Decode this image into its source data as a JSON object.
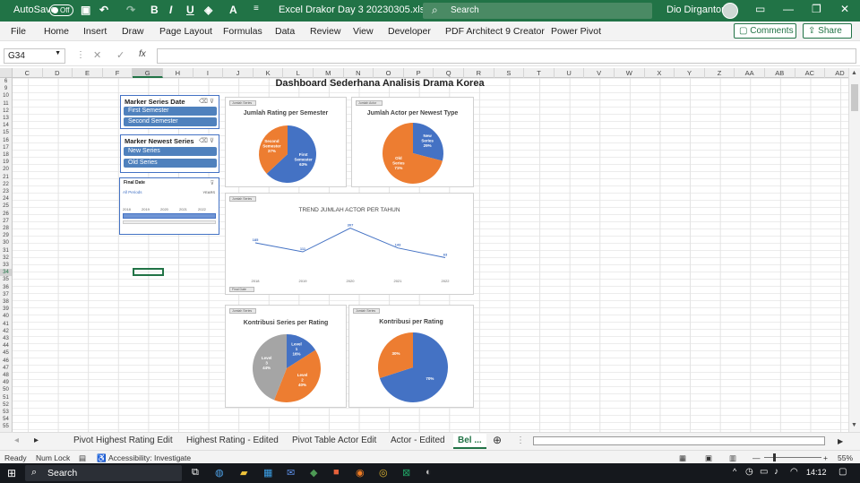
{
  "titlebar": {
    "autosave_label": "AutoSave",
    "autosave_state": "Off",
    "filename": "Excel Drakor Day 3 20230305.xlsx  -  E...",
    "search_placeholder": "Search",
    "user_name": "Dio Dirgantoro"
  },
  "menu": {
    "items": [
      "File",
      "Home",
      "Insert",
      "Draw",
      "Page Layout",
      "Formulas",
      "Data",
      "Review",
      "View",
      "Developer",
      "PDF Architect 9 Creator",
      "Power Pivot"
    ],
    "comments_label": "Comments",
    "share_label": "Share"
  },
  "formula_bar": {
    "name_box": "G34",
    "fx_label": "fx",
    "formula": ""
  },
  "grid": {
    "columns": [
      "C",
      "D",
      "E",
      "F",
      "G",
      "H",
      "I",
      "J",
      "K",
      "L",
      "M",
      "N",
      "O",
      "P",
      "Q",
      "R",
      "S",
      "T",
      "U",
      "V",
      "W",
      "X",
      "Y",
      "Z",
      "AA",
      "AB",
      "AC",
      "AD"
    ],
    "rows": [
      "6",
      "9",
      "10",
      "11",
      "12",
      "13",
      "14",
      "15",
      "16",
      "17",
      "18",
      "19",
      "20",
      "21",
      "22",
      "23",
      "24",
      "25",
      "26",
      "27",
      "28",
      "29",
      "30",
      "31",
      "32",
      "33",
      "34",
      "35",
      "36",
      "37",
      "38",
      "39",
      "40",
      "41",
      "42",
      "43",
      "44",
      "45",
      "46",
      "47",
      "48",
      "49",
      "50",
      "51",
      "52",
      "53",
      "54",
      "55"
    ]
  },
  "dashboard": {
    "title": "Dashboard Sederhana Analisis Drama Korea",
    "slicer_semester": {
      "title": "Marker Series Date",
      "items": [
        "First Semester",
        "Second Semester"
      ]
    },
    "slicer_newest": {
      "title": "Marker Newest Series",
      "items": [
        "New Series",
        "Old Series"
      ]
    },
    "timeline": {
      "title": "Final Date",
      "period": "All Periods",
      "unit": "YEARS",
      "years": [
        "2018",
        "2019",
        "2020",
        "2021",
        "2022"
      ]
    },
    "field_button": "Jumlah Series",
    "field_button_actor": "Jumlah Actor",
    "field_button_date": "Final Date"
  },
  "chart_data": [
    {
      "type": "pie",
      "title": "Jumlah Rating per Semester",
      "categories": [
        "First Semester",
        "Second Semester"
      ],
      "values": [
        63,
        37
      ],
      "colors": [
        "#4472c4",
        "#ed7d31"
      ]
    },
    {
      "type": "pie",
      "title": "Jumlah Actor per Newest Type",
      "categories": [
        "New Series",
        "Old Series"
      ],
      "values": [
        29,
        71
      ],
      "colors": [
        "#4472c4",
        "#ed7d31"
      ]
    },
    {
      "type": "line",
      "title": "TREND JUMLAH ACTOR PER TAHUN",
      "x": [
        "2018",
        "2019",
        "2020",
        "2021",
        "2022"
      ],
      "y": [
        185,
        111,
        307,
        143,
        63
      ],
      "color": "#4472c4"
    },
    {
      "type": "pie",
      "title": "Kontribusi Series per Rating",
      "categories": [
        "Level 1",
        "Level 2",
        "Level 3"
      ],
      "values": [
        16,
        40,
        44
      ],
      "colors": [
        "#4472c4",
        "#ed7d31",
        "#a5a5a5"
      ]
    },
    {
      "type": "pie",
      "title": "Kontribusi per Rating",
      "categories": [
        "",
        ""
      ],
      "values": [
        70,
        30
      ],
      "colors": [
        "#4472c4",
        "#ed7d31"
      ]
    }
  ],
  "sheet_tabs": [
    "Pivot Highest Rating Edit",
    "Highest Rating - Edited",
    "Pivot Table Actor Edit",
    "Actor - Edited",
    "Bel ..."
  ],
  "statusbar": {
    "ready": "Ready",
    "numlock": "Num Lock",
    "accessibility": "Accessibility: Investigate",
    "zoom": "55%"
  },
  "taskbar": {
    "search": "Search",
    "time": "14:12"
  }
}
